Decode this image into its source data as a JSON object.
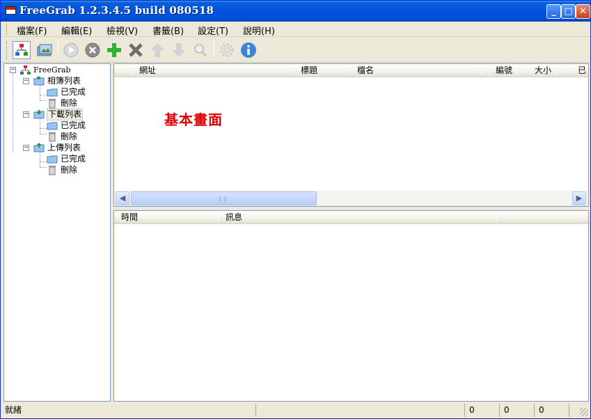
{
  "window": {
    "title": "FreeGrab 1.2.3.4.5 build 080518"
  },
  "title_buttons": {
    "minimize": "_",
    "maximize": "□",
    "close": "✕"
  },
  "menu": {
    "items": [
      {
        "label": "檔案(F)"
      },
      {
        "label": "編輯(E)"
      },
      {
        "label": "檢視(V)"
      },
      {
        "label": "書籤(B)"
      },
      {
        "label": "設定(T)"
      },
      {
        "label": "說明(H)"
      }
    ]
  },
  "toolbar": {
    "buttons": [
      {
        "icon": "site-tree-icon"
      },
      {
        "icon": "albums-icon"
      },
      {
        "icon": "play-icon"
      },
      {
        "icon": "stop-icon"
      },
      {
        "icon": "add-icon"
      },
      {
        "icon": "delete-icon"
      },
      {
        "icon": "move-up-icon"
      },
      {
        "icon": "move-down-icon"
      },
      {
        "icon": "search-icon"
      },
      {
        "icon": "settings-gear-icon"
      },
      {
        "icon": "info-icon"
      }
    ]
  },
  "tree": {
    "root": "FreeGrab",
    "groups": [
      {
        "label": "相簿列表",
        "children": [
          "已完成",
          "刪除"
        ]
      },
      {
        "label": "下載列表",
        "children": [
          "已完成",
          "刪除"
        ],
        "selected": true
      },
      {
        "label": "上傳列表",
        "children": [
          "已完成",
          "刪除"
        ]
      }
    ]
  },
  "main_list": {
    "columns": [
      "網址",
      "標題",
      "檔名",
      "編號",
      "大小",
      "已"
    ],
    "overlay_label": "基本畫面"
  },
  "log_list": {
    "columns": [
      "時間",
      "訊息"
    ]
  },
  "statusbar": {
    "text": "就緒",
    "counters": [
      "0",
      "0",
      "0"
    ]
  },
  "colors": {
    "titlebar": "#0053e1",
    "overlay_text": "#e00000",
    "pane_border": "#7f9db9",
    "chrome": "#ece9d8"
  }
}
